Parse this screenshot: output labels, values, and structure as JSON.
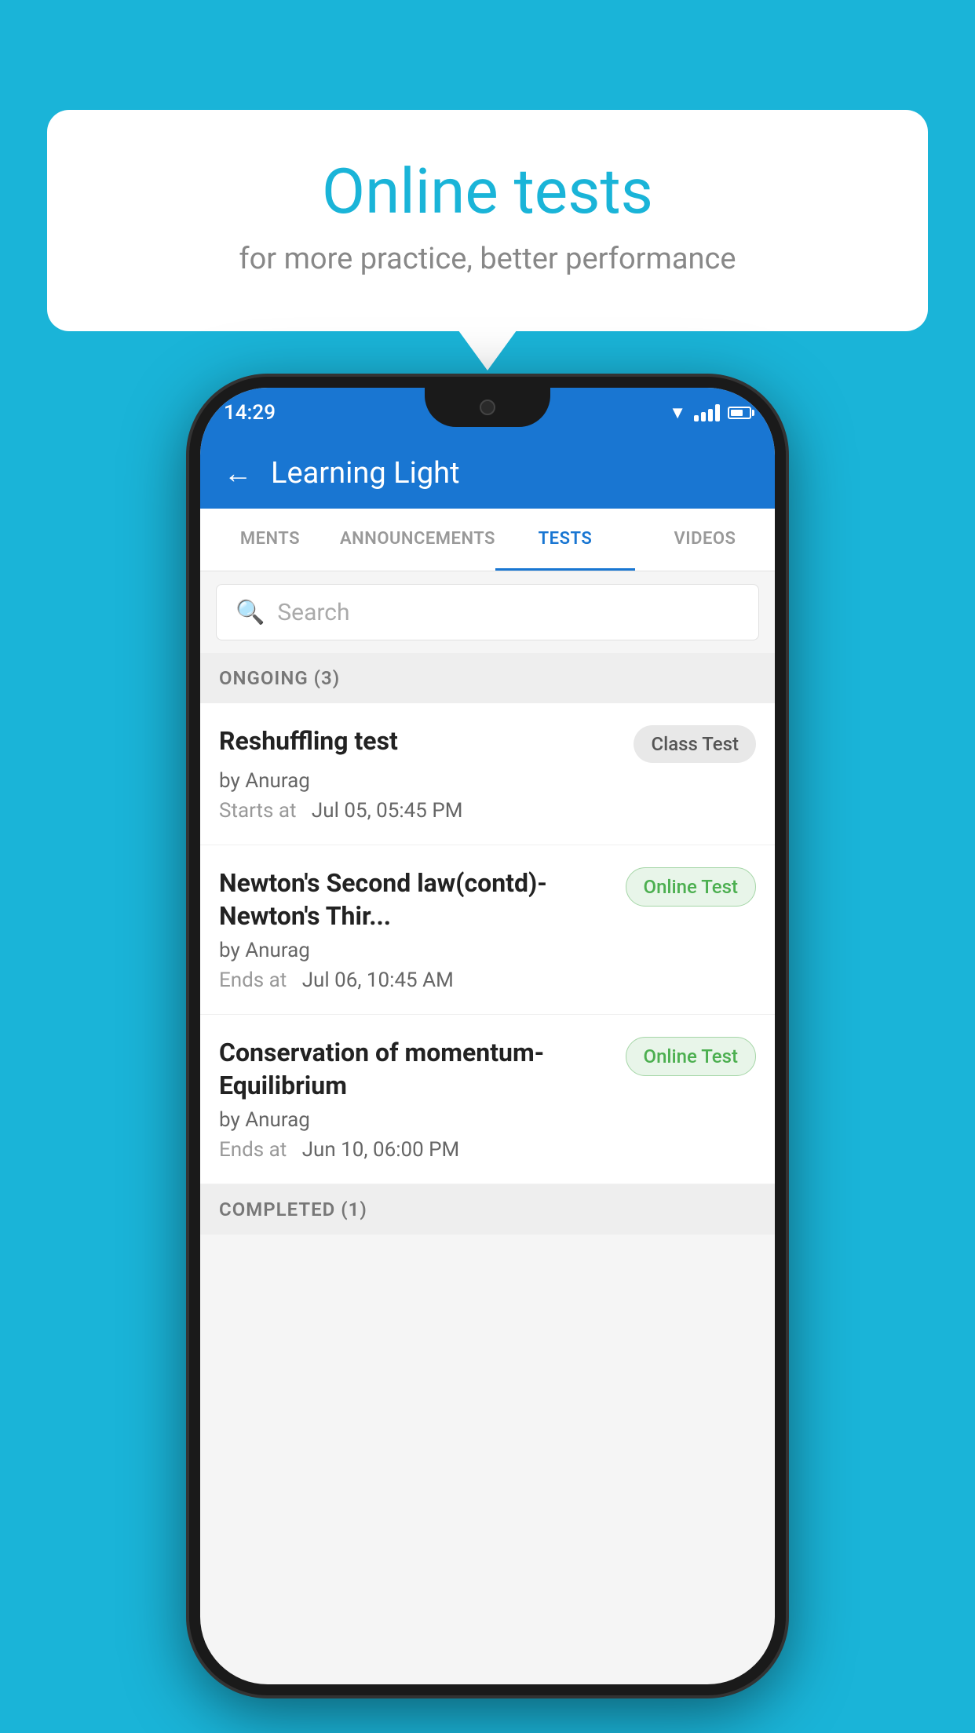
{
  "background": {
    "color": "#1ab4d8"
  },
  "speech_bubble": {
    "title": "Online tests",
    "subtitle": "for more practice, better performance"
  },
  "phone": {
    "status_bar": {
      "time": "14:29"
    },
    "header": {
      "title": "Learning Light",
      "back_label": "←"
    },
    "tabs": [
      {
        "label": "MENTS",
        "active": false
      },
      {
        "label": "ANNOUNCEMENTS",
        "active": false
      },
      {
        "label": "TESTS",
        "active": true
      },
      {
        "label": "VIDEOS",
        "active": false
      }
    ],
    "search": {
      "placeholder": "Search"
    },
    "ongoing_section": {
      "label": "ONGOING (3)"
    },
    "tests": [
      {
        "name": "Reshuffling test",
        "badge": "Class Test",
        "badge_type": "class",
        "author": "by Anurag",
        "date_label": "Starts at",
        "date": "Jul 05, 05:45 PM"
      },
      {
        "name": "Newton's Second law(contd)-Newton's Thir...",
        "badge": "Online Test",
        "badge_type": "online",
        "author": "by Anurag",
        "date_label": "Ends at",
        "date": "Jul 06, 10:45 AM"
      },
      {
        "name": "Conservation of momentum-Equilibrium",
        "badge": "Online Test",
        "badge_type": "online",
        "author": "by Anurag",
        "date_label": "Ends at",
        "date": "Jun 10, 06:00 PM"
      }
    ],
    "completed_section": {
      "label": "COMPLETED (1)"
    }
  }
}
